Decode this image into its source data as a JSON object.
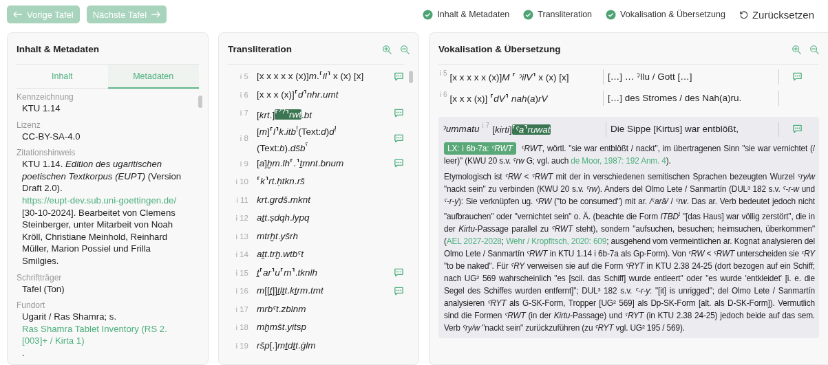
{
  "nav": [
    {
      "label": "Vorige Tafel",
      "kind": "prev",
      "disabled": true
    },
    {
      "label": "Nächste Tafel",
      "kind": "next",
      "disabled": true
    }
  ],
  "panel_toggles": [
    {
      "label": "Inhalt & Metadaten",
      "checked": true
    },
    {
      "label": "Transliteration",
      "checked": true
    },
    {
      "label": "Vokalisation & Übersetzung",
      "checked": true
    }
  ],
  "reset": {
    "label": "Zurücksetzen"
  },
  "metadata_panel": {
    "title": "Inhalt & Metadaten",
    "tabs": [
      {
        "label": "Inhalt",
        "selected": false
      },
      {
        "label": "Metadaten",
        "selected": true
      }
    ],
    "fields": [
      {
        "label": "Kennzeichnung",
        "value": [
          {
            "kind": "text",
            "text": "KTU 1.14"
          }
        ]
      },
      {
        "label": "Lizenz",
        "value": [
          {
            "kind": "text",
            "text": "CC-BY-SA-4.0"
          }
        ]
      },
      {
        "label": "Zitationshinweis",
        "value": [
          {
            "kind": "text",
            "text": "KTU 1.14. *Edition des ugaritischen poetischen Textkorpus (EUPT)* (Version Draft 2.0). "
          },
          {
            "kind": "link",
            "text": "https://eupt-dev.sub.uni-goettingen.de/"
          },
          {
            "kind": "text",
            "text": " [30-10-2024]. Bearbeitet von Clemens Steinberger, unter Mitarbeit von Noah Kröll, Christiane Meinhold, Reinhard Müller, Marion Possiel und Frilla Smilgies."
          }
        ]
      },
      {
        "label": "Schriftträger",
        "value": [
          {
            "kind": "text",
            "text": "Tafel (Ton)"
          }
        ]
      },
      {
        "label": "Fundort",
        "value": [
          {
            "kind": "text",
            "text": "Ugarit / Ras Shamra; s. "
          },
          {
            "kind": "link",
            "text": "Ras Shamra Tablet Inventory (RS 2.[003]+ / Kirta 1)"
          },
          {
            "kind": "text",
            "text": "."
          }
        ]
      }
    ]
  },
  "transliteration_panel": {
    "title": "Transliteration",
    "lines": [
      {
        "number": "i 5",
        "comment": true,
        "parts": [
          {
            "text": "[x x x x x (x)]*m*.⸢*il*⸣ x (x) [x]",
            "highlighted": false
          }
        ]
      },
      {
        "number": "i 6",
        "comment": false,
        "parts": [
          {
            "text": "[x x x (x)]⸢*d*⸣*nhr*.*umt*",
            "highlighted": false
          }
        ]
      },
      {
        "number": "i 7",
        "comment": true,
        "parts": [
          {
            "text": "[*krt*.]",
            "highlighted": false
          },
          {
            "text": "⸢$^{ˀ?}$⸣*rwt*",
            "highlighted": true
          },
          {
            "text": ".*bt*",
            "highlighted": false
          }
        ]
      },
      {
        "number": "i 8",
        "comment": true,
        "parts": [
          {
            "text": "[*m*]⸢*l*⸣*k*.*itb*$^{!}$(Text:*d*)*d*$^{!}$(Text:*b*).*dšb*$^{ˤ}$",
            "highlighted": false
          }
        ]
      },
      {
        "number": "i 9",
        "comment": true,
        "parts": [
          {
            "text": "[*a*]*ḫm*.*lh*⸢.⸣*ṯmnt*.*bnum*",
            "highlighted": false
          }
        ]
      },
      {
        "number": "i 10",
        "comment": false,
        "parts": [
          {
            "text": "⸢*k*⸣*rt*.*ḥtkn*.*rš*",
            "highlighted": false
          }
        ]
      },
      {
        "number": "i 11",
        "comment": false,
        "parts": [
          {
            "text": "*krt*.*grdš*.*mknt*",
            "highlighted": false
          }
        ]
      },
      {
        "number": "i 12",
        "comment": false,
        "parts": [
          {
            "text": "*aṯt*.*ṣdqh*.*lypq*",
            "highlighted": false
          }
        ]
      },
      {
        "number": "i 13",
        "comment": false,
        "parts": [
          {
            "text": "*mtrḫt*.*yšrh*",
            "highlighted": false
          }
        ]
      },
      {
        "number": "i 14",
        "comment": false,
        "parts": [
          {
            "text": "*aṯt*.*trḫ*.*wtbˤt*",
            "highlighted": false
          }
        ]
      },
      {
        "number": "i 15",
        "comment": true,
        "parts": [
          {
            "text": "*ṯ*⸢*ar*⸣*u*⸢*m*⸣.*tknlh*",
            "highlighted": false
          }
        ]
      },
      {
        "number": "i 16",
        "comment": true,
        "parts": [
          {
            "text": "*m*[[*ṯ*]]*ṯlṯt*.*kṯrm*.*tmt*",
            "highlighted": false
          }
        ]
      },
      {
        "number": "i 17",
        "comment": false,
        "parts": [
          {
            "text": "*mrbˤt*.*zblnm*",
            "highlighted": false
          }
        ]
      },
      {
        "number": "i 18",
        "comment": false,
        "parts": [
          {
            "text": "*mḫmšt*.*yitsp*",
            "highlighted": false
          }
        ]
      },
      {
        "number": "i 19",
        "comment": false,
        "parts": [
          {
            "text": "*ršp*[.]*mṯdṯt*.*ġlm*",
            "highlighted": false
          }
        ]
      }
    ]
  },
  "vocalisation_panel": {
    "title": "Vokalisation & Übersetzung",
    "rows": [
      {
        "number": "i 5",
        "selected": false,
        "comment": true,
        "translation": "[…] … ˀIlu / Gott […]",
        "parts": [
          {
            "text": "[x x x x x (x)]*M* ⸢ *ˀilV*⸣ x (x) [x]",
            "highlighted": false
          }
        ]
      },
      {
        "number": "i 6",
        "selected": false,
        "comment": false,
        "translation": "[…] des Stromes / des Nah(a)ru.",
        "parts": [
          {
            "text": "[x x x (x)] ⸢*dV*⸣ *nah*(*a*)*rV*",
            "highlighted": false
          }
        ]
      },
      {
        "number": "i 7",
        "selected": true,
        "comment": true,
        "lead": "ˀummatu",
        "translation": "Die Sippe [Kirtus] war entblößt,",
        "parts": [
          {
            "text": "[*kirti*]",
            "highlighted": false
          },
          {
            "text": "⸢*ˤa*⸣*ruwat*",
            "highlighted": true
          }
        ],
        "notes": [
          [
            {
              "kind": "tag",
              "text": "LX: i 6b-7a: *ˤRWT*"
            },
            {
              "kind": "text",
              "text": "*ˤRWT*, wörtl. \"sie war entblößt / nackt\", im übertragenen Sinn \"sie war vernichtet (/ leer)\" (KWU 20 s.v. *ˤrw* G; vgl. auch "
            },
            {
              "kind": "link",
              "text": "de Moor, 1987: 192 Anm. 4"
            },
            {
              "kind": "text",
              "text": ")."
            }
          ],
          [
            {
              "kind": "text",
              "text": "Etymologisch ist *ˤRW* < *ˤRWT* mit der in verschiedenen semitischen Sprachen bezeugten Wurzel *ˤry/w* \"nackt sein\" zu verbinden (KWU 20 s.v. *ˤrw*). Anders del Olmo Lete / Sanmartín (DUL³ 182 s.v. *ˤ-r-w* und *ˤ-r-y*): Sie verknüpfen ug. *ˤRW* (\"to be consumed\") mit ar. */ˤarā/* / *ˤrw*. Das ar. Verb bedeutet jedoch nicht \"aufbrauchen\" oder \"vernichtet sein\" o. Ä. (beachte die Form *ITBD*$^{!}$ \"[das Haus] war völlig zerstört\", die in der *Kirtu*-Passage parallel zu *ˤRWT* steht), sondern \"aufsuchen, besuchen; heimsuchen, überkommen\" ("
            },
            {
              "kind": "link",
              "text": "AEL 2027-2028"
            },
            {
              "kind": "text",
              "text": "; "
            },
            {
              "kind": "link",
              "text": "Wehr / Kropfitsch, 2020: 609"
            },
            {
              "kind": "text",
              "text": "; ausgehend vom vermeintlichen ar. Kognat analysieren del Olmo Lete / Sanmartín *ˤRWT* in KTU 1.14 i 6b-7a als Gp-Form). Von *ˤRW* < *ˤRWT* unterscheiden sie *ˤRY* \"to be naked\". Für *ˤRY* verweisen sie auf die Form *ˤRYT* in KTU 2.38 24-25 (dort bezogen auf ein Schiff; nach UG² 569 wahrscheinlich \"es [scil. das Schiff] wurde entleert\" oder \"es wurde 'entkleidet' [i. e. die Segel des Schiffes wurden entfernt]\"; DUL³ 182 s.v. *ˤ-r-y*: \"[it] is unrigged\"; del Olmo Lete / Sanmartín analysieren *ˤRYT* als G-SK-Form, Tropper [UG² 569] als Dp-SK-Form [alt. als D-SK-Form]). Vermutlich sind die Formen *ˤRWT* (in der *Kirtu*-Passage) und *ˤRYT* (in KTU 2.38 24-25) jedoch beide auf das sem. Verb *ˤry/w* \"nackt sein\" zurückzuführen (zu *ˤRYT* vgl. UG² 195 / 569)."
            }
          ]
        ]
      }
    ]
  }
}
